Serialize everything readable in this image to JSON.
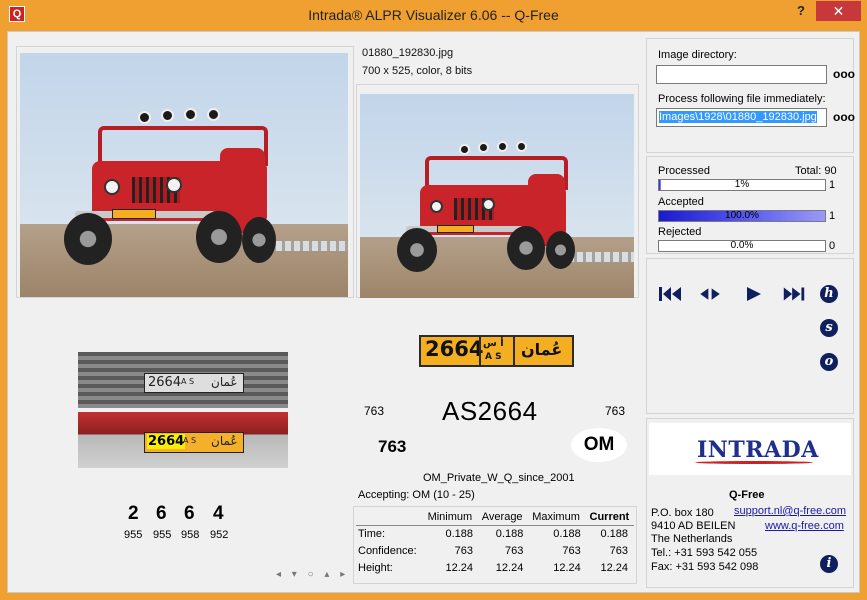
{
  "window": {
    "app_icon": "Q",
    "title": "Intrada® ALPR Visualizer 6.06  --  Q-Free",
    "help_label": "?",
    "close_label": "✕"
  },
  "image_info": {
    "filename": "01880_192830.jpg",
    "details": "700 x 525, color, 8 bits"
  },
  "plate_read": {
    "plate_number": "2664",
    "plate_letters": "A S",
    "plate_arabic_small": "أ س",
    "plate_country_arabic": "عُمان",
    "gray_plate_number": "2664",
    "orange_plate_number": "2664",
    "result_text": "AS2664",
    "left_score": "763",
    "right_score": "763",
    "confidence_bold": "763",
    "country": "OM",
    "syntax": "OM_Private_W_Q_since_2001",
    "accepting": "Accepting: OM (10 - 25)"
  },
  "characters": [
    {
      "char": "2",
      "conf": "955"
    },
    {
      "char": "6",
      "conf": "955"
    },
    {
      "char": "6",
      "conf": "958"
    },
    {
      "char": "4",
      "conf": "952"
    }
  ],
  "char_nav": "◂ ▾ ○ ▴ ▸",
  "stats": {
    "headers": [
      "",
      "Minimum",
      "Average",
      "Maximum",
      "Current"
    ],
    "rows": [
      {
        "label": "Time:",
        "min": "0.188",
        "avg": "0.188",
        "max": "0.188",
        "cur": "0.188"
      },
      {
        "label": "Confidence:",
        "min": "763",
        "avg": "763",
        "max": "763",
        "cur": "763"
      },
      {
        "label": "Height:",
        "min": "12.24",
        "avg": "12.24",
        "max": "12.24",
        "cur": "12.24"
      }
    ]
  },
  "settings": {
    "image_dir_label": "Image directory:",
    "image_dir_value": "",
    "process_label": "Process following file immediately:",
    "process_value": "Images\\1928\\01880_192830.jpg",
    "browse_label": "ooo"
  },
  "progress": {
    "processed_label": "Processed",
    "total_label": "Total: 90",
    "processed_pct": 1,
    "processed_text": "1%",
    "processed_count": "1",
    "accepted_label": "Accepted",
    "accepted_pct": 100,
    "accepted_text": "100.0%",
    "accepted_count": "1",
    "rejected_label": "Rejected",
    "rejected_pct": 0,
    "rejected_text": "0.0%",
    "rejected_count": "0"
  },
  "controls": {
    "h_label": "h",
    "s_label": "s",
    "o_label": "o",
    "info_label": "i"
  },
  "company": {
    "logo": "INTRADA",
    "name": "Q-Free",
    "address1": "P.O. box 180",
    "address2": "9410 AD  BEILEN",
    "address3": "The Netherlands",
    "tel": "Tel.: +31 593 542 055",
    "fax": "Fax: +31 593 542 098",
    "email": "support.nl@q-free.com",
    "web": "www.q-free.com"
  },
  "colors": {
    "title_bar": "#f0a030",
    "close": "#c7383a",
    "progress_fill": "#1a1ad0",
    "plate": "#f3ae22",
    "icon_navy": "#10205e"
  }
}
